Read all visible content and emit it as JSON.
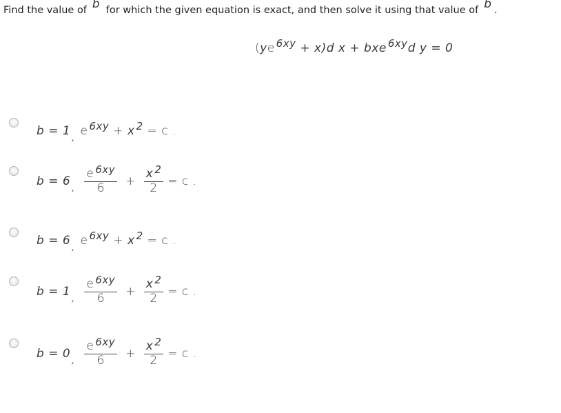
{
  "question": {
    "part1": "Find the value of",
    "var": "b",
    "part2": "for which the given equation is exact, and then solve it using that value of",
    "end": "."
  },
  "equation": {
    "lhs_open": "(",
    "y": "y",
    "e": "e",
    "exp": "6xy",
    "plus_x": " + x)",
    "dx": "d x + ",
    "b": "b",
    "xe": "xe",
    "exp2": "6xy",
    "dy": "d y = 0"
  },
  "options": [
    {
      "b_value": "b = 1",
      "type": "sum",
      "e": "e",
      "exp": "6xy",
      "plus": "+",
      "x": "x",
      "x_exp": "2",
      "rhs": "= c ."
    },
    {
      "b_value": "b = 6",
      "type": "frac",
      "e": "e",
      "exp": "6xy",
      "den1": "6",
      "plus": "+",
      "x": "x",
      "x_exp": "2",
      "den2": "2",
      "rhs": "= c ."
    },
    {
      "b_value": "b = 6",
      "type": "sum",
      "e": "e",
      "exp": "6xy",
      "plus": "+",
      "x": "x",
      "x_exp": "2",
      "rhs": "= c ."
    },
    {
      "b_value": "b = 1",
      "type": "frac",
      "e": "e",
      "exp": "6xy",
      "den1": "6",
      "plus": "+",
      "x": "x",
      "x_exp": "2",
      "den2": "2",
      "rhs": "= c ."
    },
    {
      "b_value": "b = 0",
      "type": "frac",
      "e": "e",
      "exp": "6xy",
      "den1": "6",
      "plus": "+",
      "x": "x",
      "x_exp": "2",
      "den2": "2",
      "rhs": "= c ."
    }
  ],
  "comma": ","
}
